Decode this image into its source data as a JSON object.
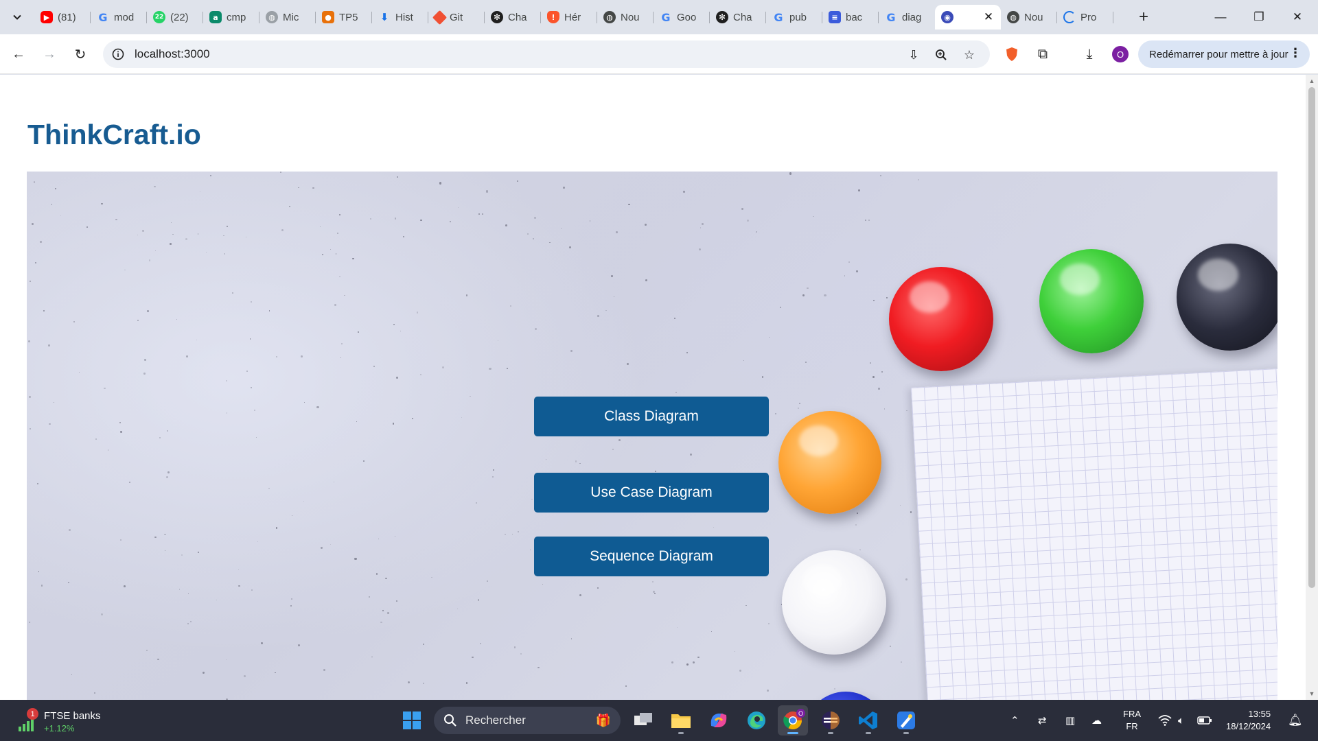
{
  "browser": {
    "tabs": [
      {
        "label": "(81)",
        "icon": "youtube-icon"
      },
      {
        "label": "mod",
        "icon": "google-icon"
      },
      {
        "label": "(22)",
        "icon": "whatsapp-icon"
      },
      {
        "label": "cmp",
        "icon": "app-icon"
      },
      {
        "label": "Mic",
        "icon": "globe-icon"
      },
      {
        "label": "TP5",
        "icon": "contact-icon"
      },
      {
        "label": "Hist",
        "icon": "download-icon"
      },
      {
        "label": "Git",
        "icon": "git-icon"
      },
      {
        "label": "Cha",
        "icon": "chatgpt-icon"
      },
      {
        "label": "Hér",
        "icon": "brave-icon"
      },
      {
        "label": "Nou",
        "icon": "globe-icon"
      },
      {
        "label": "Goo",
        "icon": "google-icon"
      },
      {
        "label": "Cha",
        "icon": "chatgpt-icon"
      },
      {
        "label": "pub",
        "icon": "google-icon"
      },
      {
        "label": "bac",
        "icon": "forms-icon"
      },
      {
        "label": "diag",
        "icon": "google-icon"
      },
      {
        "label": "",
        "icon": "thinkcraft-icon",
        "active": true
      },
      {
        "label": "Nou",
        "icon": "globe-icon"
      },
      {
        "label": "Pro",
        "icon": "loading-icon"
      }
    ],
    "address": "localhost:3000",
    "update_button": "Redémarrer pour mettre à jour",
    "profile_initial": "O"
  },
  "page": {
    "brand": "ThinkCraft.io",
    "buttons": {
      "class": "Class Diagram",
      "usecase": "Use Case Diagram",
      "sequence": "Sequence Diagram"
    }
  },
  "taskbar": {
    "widget_badge": "1",
    "widget_title": "FTSE banks",
    "widget_value": "+1.12%",
    "search_placeholder": "Rechercher",
    "lang_top": "FRA",
    "lang_bottom": "FR",
    "time": "13:55",
    "date": "18/12/2024"
  },
  "colors": {
    "brand": "#175b91",
    "button": "#0f5b93",
    "taskbar": "#2a2d3a"
  }
}
